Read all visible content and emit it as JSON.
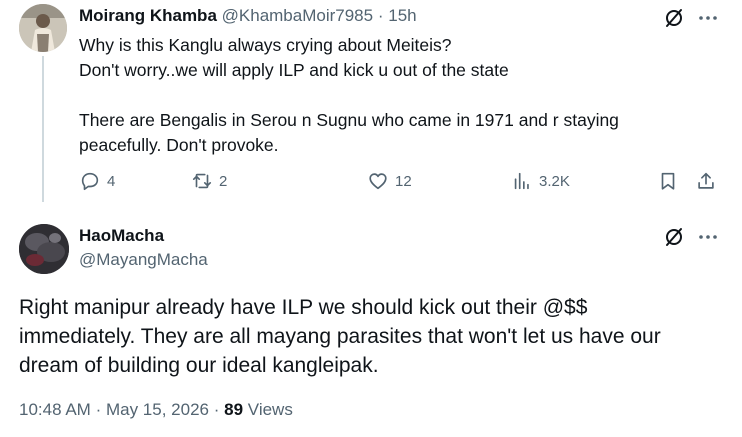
{
  "tweet1": {
    "name": "Moirang Khamba",
    "handle": "@KhambaMoir7985",
    "separator": "·",
    "time": "15h",
    "lines": [
      "Why is this Kanglu always crying about Meiteis?",
      "Don't worry..we will apply ILP and kick u out of the state",
      "",
      "There are Bengalis in Serou n Sugnu who came in 1971 and r staying",
      "peacefully. Don't provoke."
    ],
    "replies": "4",
    "reposts": "2",
    "likes": "12",
    "views": "3.2K"
  },
  "tweet2": {
    "name": "HaoMacha",
    "handle": "@MayangMacha",
    "lines": [
      "Right manipur already have ILP we should kick out their @$$",
      "immediately. They are all mayang parasites that won't let us have our",
      "dream of building our ideal kangleipak."
    ],
    "time": "10:48 AM",
    "dot": "·",
    "date": "May 15, 2026",
    "views_count": "89",
    "views_label": "Views"
  },
  "colors": {
    "text": "#0f1419",
    "muted": "#536471",
    "thread_line": "#cfd9de"
  },
  "icons": {
    "reply": "reply-icon",
    "repost": "repost-icon",
    "like": "heart-icon",
    "views": "views-chart-icon",
    "bookmark": "bookmark-icon",
    "share": "share-icon",
    "grok": "grok-icon",
    "more": "more-icon"
  }
}
